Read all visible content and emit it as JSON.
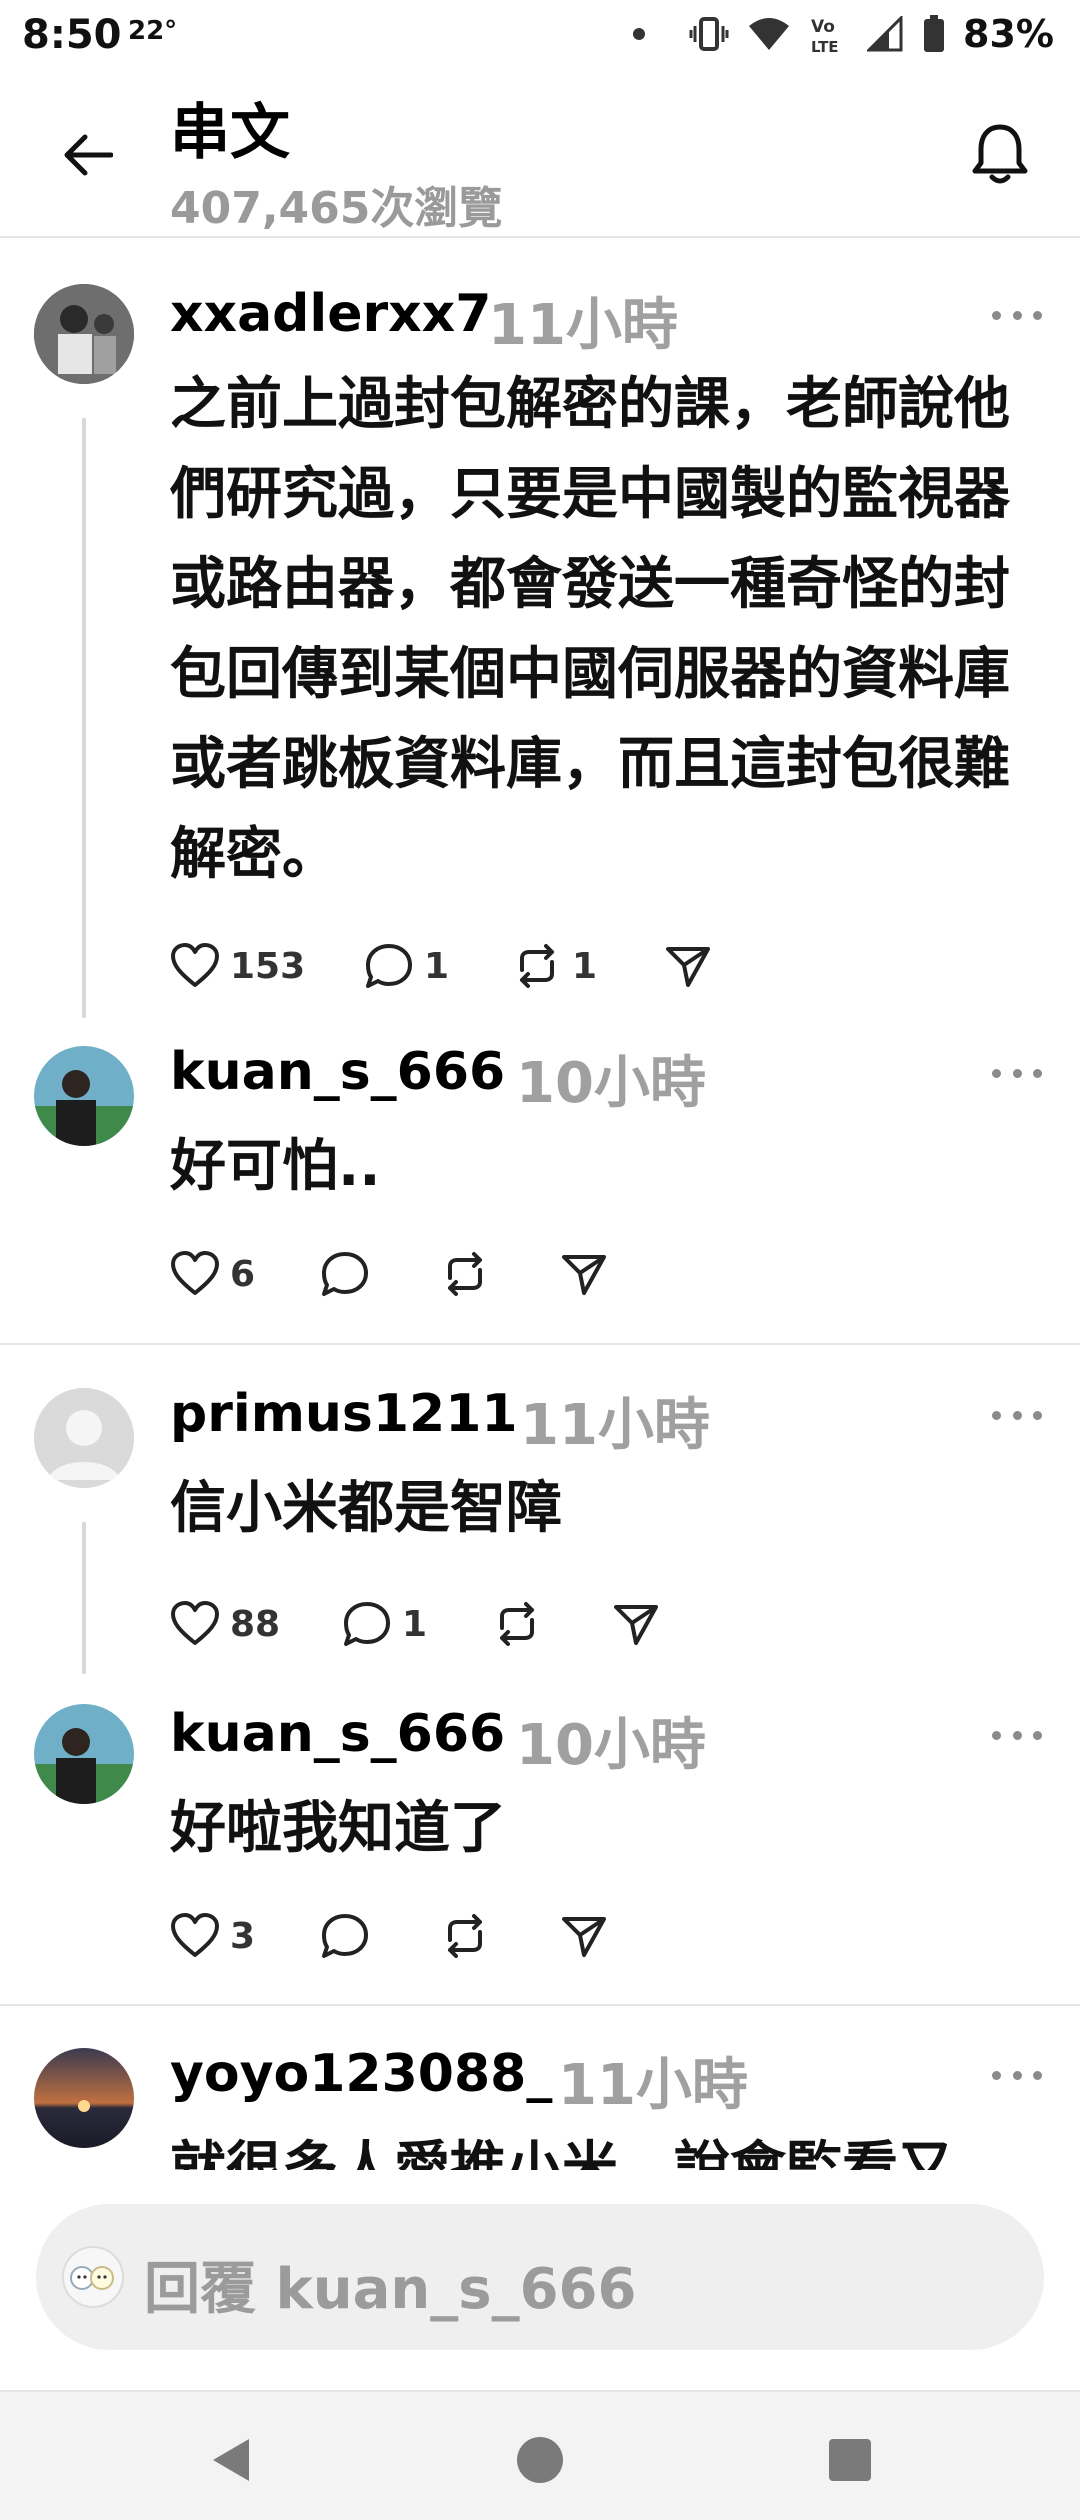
{
  "status_bar": {
    "time": "8:50",
    "temperature": "22°",
    "battery": "83%",
    "network": "VoLTE"
  },
  "header": {
    "title": "串文",
    "views": "407,465次瀏覽"
  },
  "posts": [
    {
      "username": "xxadlerxx7",
      "time": "11小時",
      "text": "之前上過封包解密的課，老師說他們研究過，只要是中國製的監視器或路由器，都會發送一種奇怪的封包回傳到某個中國伺服器的資料庫或者跳板資料庫，而且這封包很難解密。",
      "likes": "153",
      "comments": "1",
      "reposts": "1"
    },
    {
      "username": "kuan_s_666",
      "time": "10小時",
      "text": "好可怕..",
      "likes": "6",
      "comments": "",
      "reposts": ""
    },
    {
      "username": "primus1211",
      "time": "11小時",
      "text": "信小米都是智障",
      "likes": "88",
      "comments": "1",
      "reposts": ""
    },
    {
      "username": "kuan_s_666",
      "time": "10小時",
      "text": "好啦我知道了",
      "likes": "3",
      "comments": "",
      "reposts": ""
    },
    {
      "username": "yoyo123088_",
      "time": "11小時",
      "text": "就很多人愛推小米，說會監看又"
    }
  ],
  "reply_bar": {
    "placeholder": "回覆 kuan_s_666"
  },
  "icons": {
    "back": "arrow-left-icon",
    "notify": "bell-icon",
    "more": "more-horizontal-icon",
    "like": "heart-icon",
    "comment": "comment-icon",
    "repost": "repost-icon",
    "share": "send-icon"
  }
}
